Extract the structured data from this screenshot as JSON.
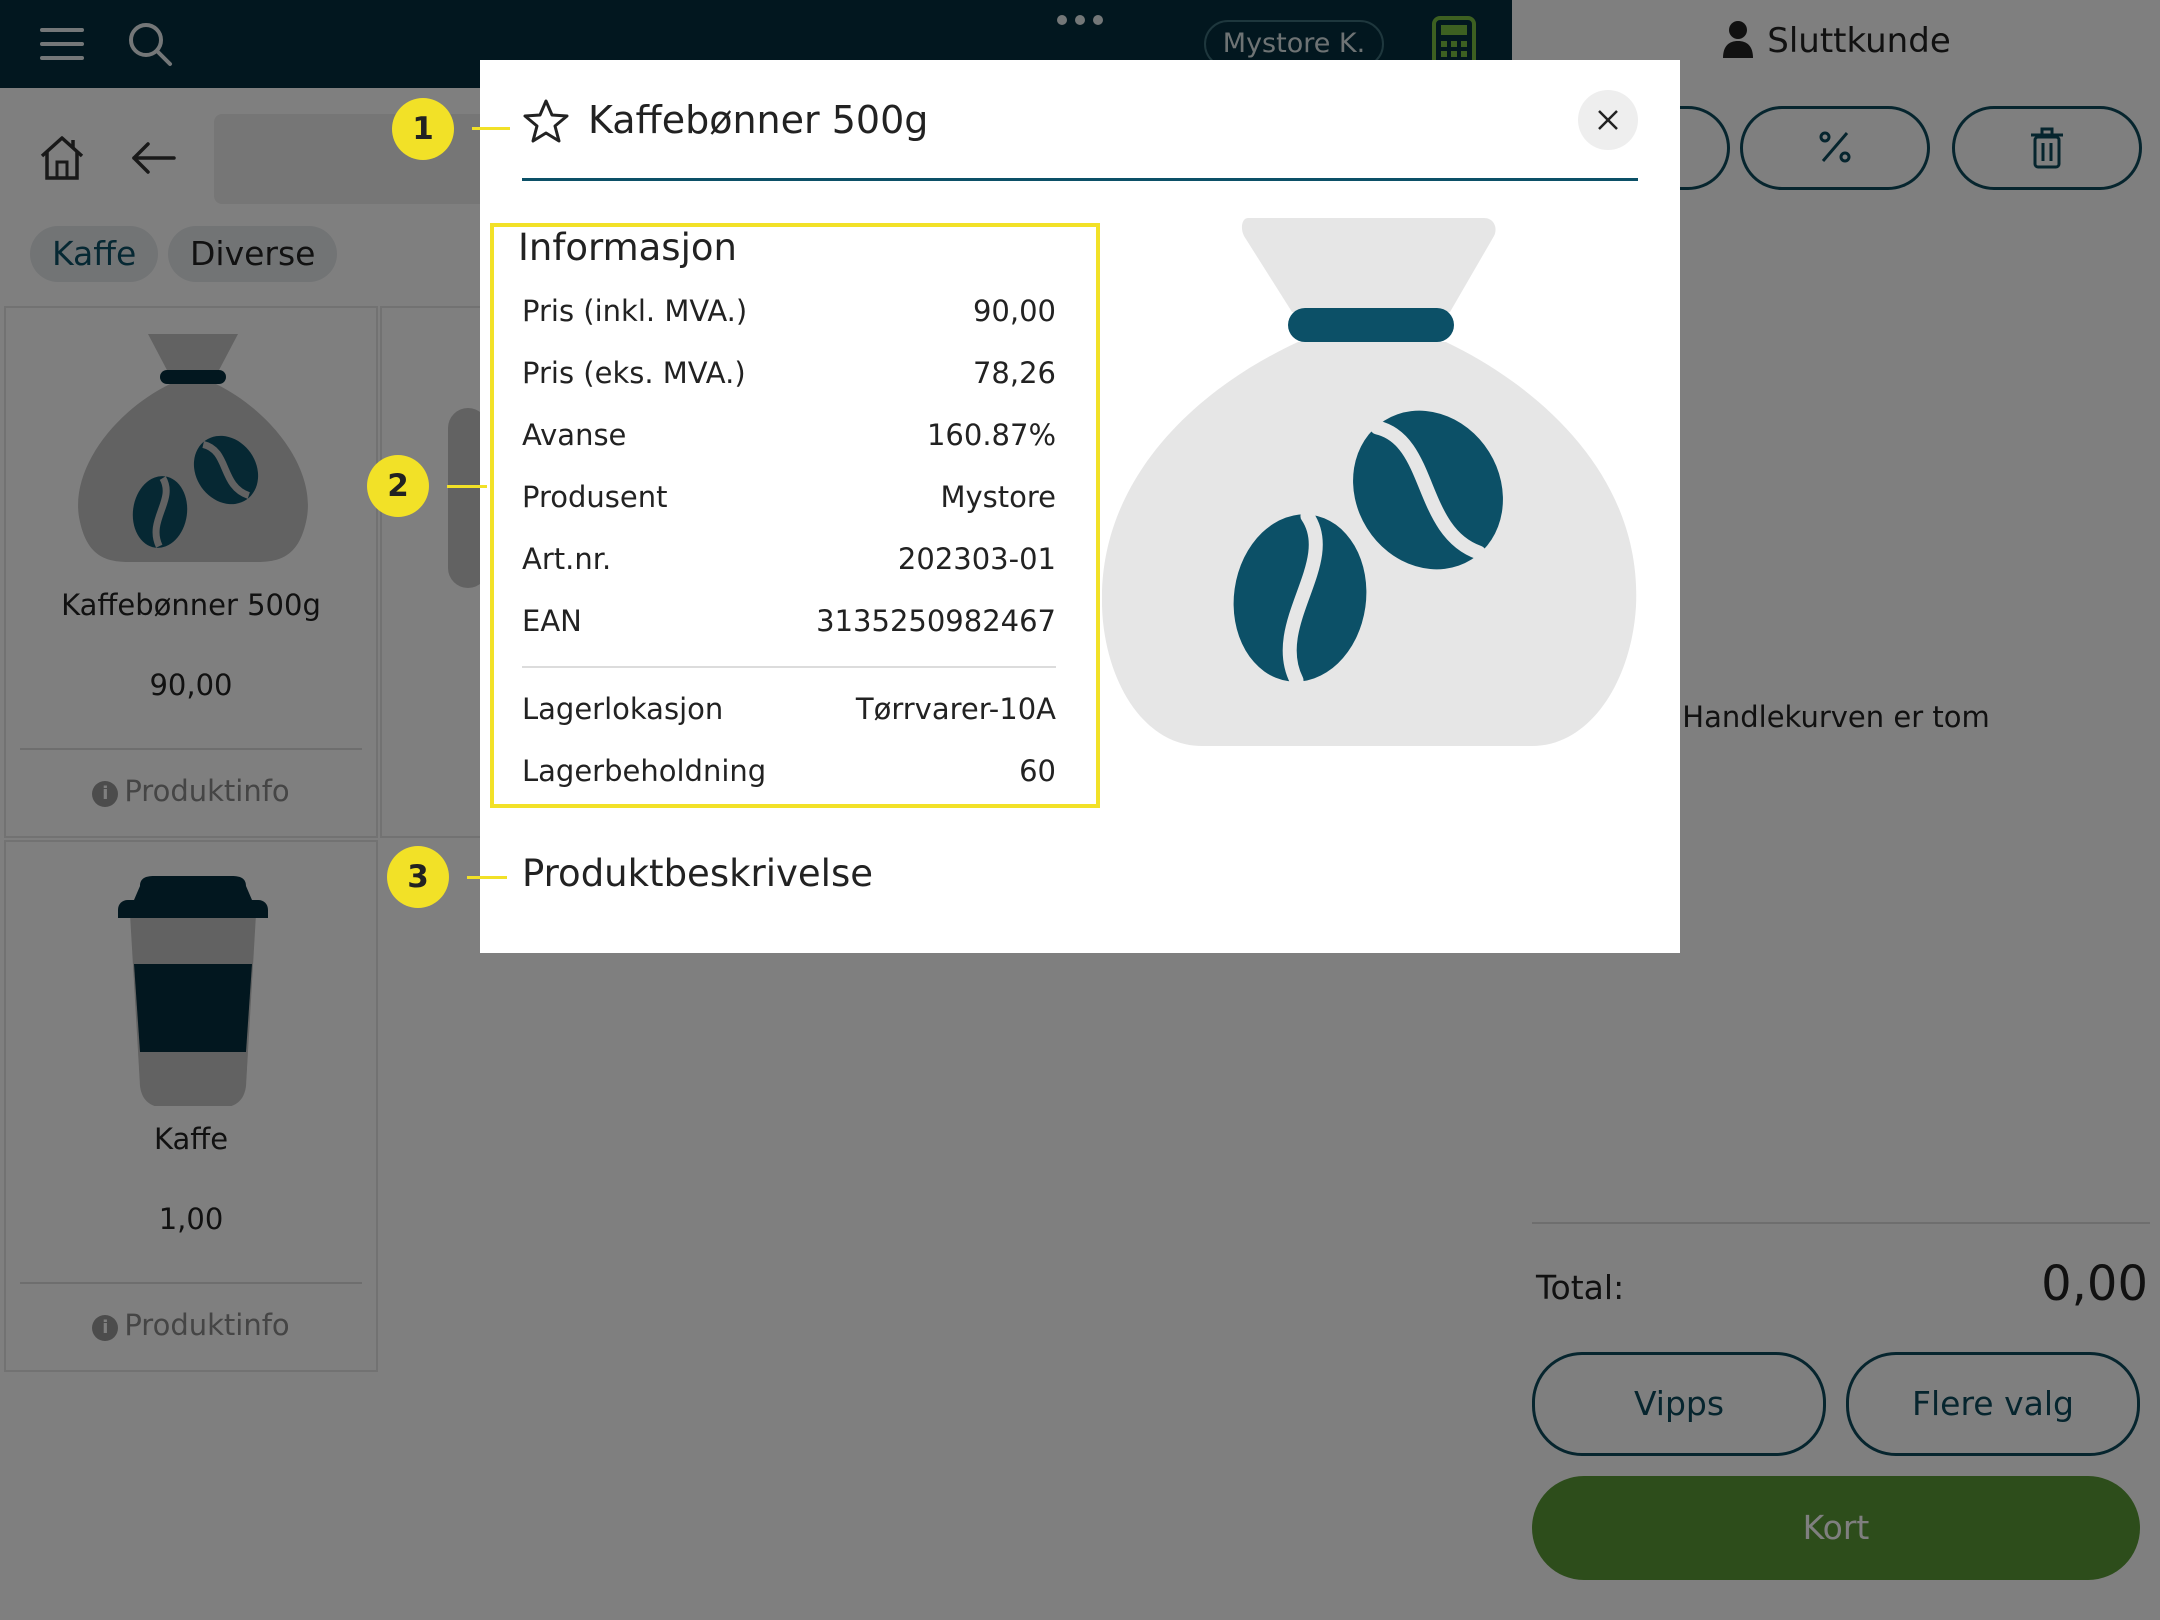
{
  "header": {
    "user_chip": "Mystore K."
  },
  "categories": [
    {
      "label": "Kaffe",
      "active": true
    },
    {
      "label": "Diverse",
      "active": false
    }
  ],
  "products": [
    {
      "name": "Kaffebønner 500g",
      "price": "90,00",
      "info_label": "Produktinfo",
      "icon": "coffee-bag-icon"
    },
    {
      "name": "Kaffe",
      "price": "1,00",
      "info_label": "Produktinfo",
      "icon": "coffee-cup-icon"
    }
  ],
  "cart": {
    "customer": "Sluttkunde",
    "empty_message": "Handlekurven er tom",
    "total_label": "Total:",
    "total_value": "0,00",
    "vipps_label": "Vipps",
    "more_label": "Flere valg",
    "card_label": "Kort"
  },
  "modal": {
    "title": "Kaffebønner 500g",
    "info_heading": "Informasjon",
    "info_rows": [
      {
        "label": "Pris (inkl. MVA.)",
        "value": "90,00"
      },
      {
        "label": "Pris (eks. MVA.)",
        "value": "78,26"
      },
      {
        "label": "Avanse",
        "value": "160.87%"
      },
      {
        "label": "Produsent",
        "value": "Mystore"
      },
      {
        "label": "Art.nr.",
        "value": "202303-01"
      },
      {
        "label": "EAN",
        "value": "3135250982467"
      }
    ],
    "stock_rows": [
      {
        "label": "Lagerlokasjon",
        "value": "Tørrvarer-10A"
      },
      {
        "label": "Lagerbeholdning",
        "value": "60"
      }
    ],
    "description_heading": "Produktbeskrivelse"
  },
  "callouts": [
    "1",
    "2",
    "3"
  ],
  "colors": {
    "header_bg": "#052f3e",
    "brand_teal": "#0c5067",
    "card_green": "#5a9a36",
    "callout_yellow": "#f2e127"
  }
}
